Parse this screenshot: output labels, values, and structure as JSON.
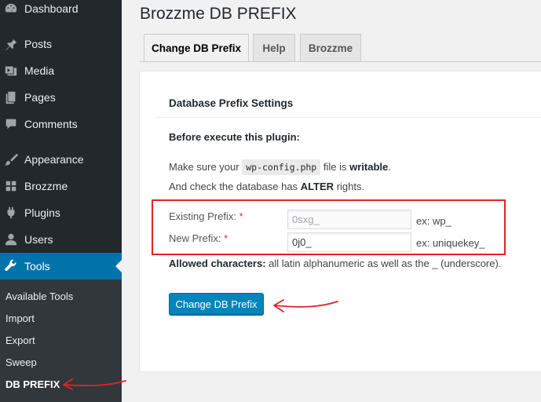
{
  "sidebar": {
    "items": [
      {
        "label": "Dashboard",
        "icon": "dashboard-icon"
      },
      {
        "label": "Posts",
        "icon": "pin-icon"
      },
      {
        "label": "Media",
        "icon": "media-icon"
      },
      {
        "label": "Pages",
        "icon": "pages-icon"
      },
      {
        "label": "Comments",
        "icon": "comment-icon"
      },
      {
        "label": "Appearance",
        "icon": "paintbrush-icon"
      },
      {
        "label": "Brozzme",
        "icon": "grid-icon"
      },
      {
        "label": "Plugins",
        "icon": "plug-icon"
      },
      {
        "label": "Users",
        "icon": "user-icon"
      },
      {
        "label": "Tools",
        "icon": "wrench-icon"
      }
    ],
    "submenu": [
      "Available Tools",
      "Import",
      "Export",
      "Sweep",
      "DB PREFIX"
    ]
  },
  "page": {
    "title": "Brozzme DB PREFIX",
    "tabs": [
      "Change DB Prefix",
      "Help",
      "Brozzme"
    ]
  },
  "settings": {
    "section_title": "Database Prefix Settings",
    "before_heading": "Before execute this plugin:",
    "make_sure": "Make sure your",
    "file_code": "wp-config.php",
    "file_is": "file is",
    "writable": "writable",
    "period": ".",
    "check_db": "And check the database has",
    "alter": "ALTER",
    "rights": "rights.",
    "existing_label": "Existing Prefix:",
    "existing_value": "0sxg_",
    "existing_example": "ex: wp_",
    "new_label": "New Prefix:",
    "new_value": "0j0_",
    "new_example": "ex: uniquekey_",
    "required_mark": "*",
    "allowed_label": "Allowed characters:",
    "allowed_text": "all latin alphanumeric as well as the _ (underscore).",
    "submit_label": "Change DB Prefix"
  },
  "colors": {
    "sidebar_bg": "#23282d",
    "active_blue": "#0073aa",
    "button_blue": "#0085ba",
    "annotation_red": "#e2232a"
  }
}
